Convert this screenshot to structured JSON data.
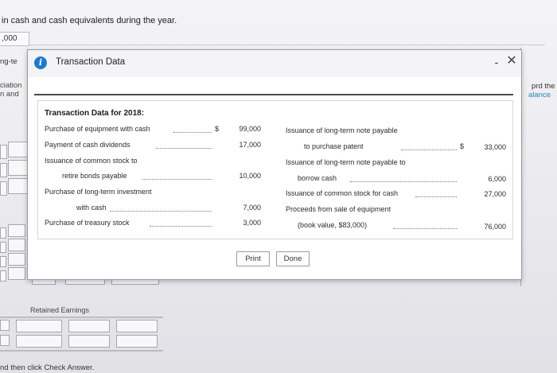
{
  "background": {
    "intro_text": "in cash and cash equivalents during the year.",
    "value_box": ",000",
    "long_term_label": "ng-te",
    "depreciation_label_1": "ciation",
    "depreciation_label_2": "n and",
    "right_label_1": "prd the",
    "right_label_2": "alance",
    "retained_label": "Retained Earnings",
    "check_answer_text": "nd then click Check Answer."
  },
  "modal": {
    "title": "Transaction Data",
    "minimize_glyph": "-",
    "close_glyph": "✕",
    "info_glyph": "i",
    "panel_title": "Transaction Data for 2018:",
    "left_rows": [
      {
        "label": "Purchase of equipment with cash",
        "dollar": "$",
        "value": "99,000"
      },
      {
        "label": "Payment of cash dividends",
        "dollar": "",
        "value": "17,000"
      },
      {
        "label": "Issuance of common stock to",
        "dollar": "",
        "value": ""
      },
      {
        "label": "retire bonds payable",
        "dollar": "",
        "value": "10,000"
      },
      {
        "label": "Purchase of long-term investment",
        "dollar": "",
        "value": ""
      },
      {
        "label": "with cash",
        "dollar": "",
        "value": "7,000"
      },
      {
        "label": "Purchase of treasury stock",
        "dollar": "",
        "value": "3,000"
      }
    ],
    "right_rows": [
      {
        "label": "Issuance of long-term note payable",
        "dollar": "",
        "value": ""
      },
      {
        "label": "to purchase patent",
        "dollar": "$",
        "value": "33,000"
      },
      {
        "label": "Issuance of long-term note payable to",
        "dollar": "",
        "value": ""
      },
      {
        "label": "borrow cash",
        "dollar": "",
        "value": "6,000"
      },
      {
        "label": "Issuance of common stock for cash",
        "dollar": "",
        "value": "27,000"
      },
      {
        "label": "Proceeds from sale of equipment",
        "dollar": "",
        "value": ""
      },
      {
        "label": "(book value, $83,000)",
        "dollar": "",
        "value": "76,000"
      }
    ],
    "print_label": "Print",
    "done_label": "Done"
  },
  "colors": {
    "info_icon": "#1f7ac9",
    "link_blue": "#2a7fb8"
  }
}
